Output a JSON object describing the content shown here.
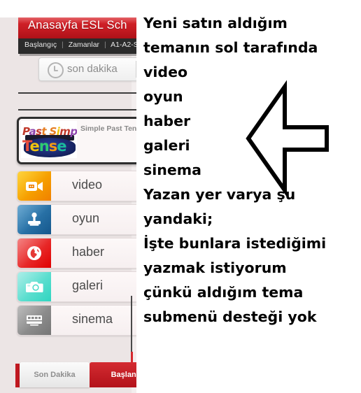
{
  "site": {
    "header": {
      "title": "Anasayfa   ESL Sch",
      "nav": [
        "Başlangıç",
        "Zamanlar",
        "A1-A2-S"
      ]
    },
    "ticker": {
      "icon": "clock-icon",
      "label": "son dakika"
    },
    "featured": {
      "thumb_line1": "Past Simple",
      "thumb_line2": "Tense",
      "title": "Simple Past Tense"
    },
    "menu": [
      {
        "label": "video",
        "icon": "video-camera-icon",
        "color": "#f39200"
      },
      {
        "label": "oyun",
        "icon": "joystick-icon",
        "color": "#1d6fa5"
      },
      {
        "label": "haber",
        "icon": "globe-icon",
        "color": "#e31e24"
      },
      {
        "label": "galeri",
        "icon": "camera-icon",
        "color": "#49d8c8"
      },
      {
        "label": "sinema",
        "icon": "film-strip-icon",
        "color": "#8c8c8c"
      }
    ],
    "tabs": [
      {
        "label": "Son Dakika",
        "active": false
      },
      {
        "label": "Başlang",
        "active": true
      }
    ]
  },
  "annotation": {
    "arrow": "left-arrow-outline",
    "lines": [
      "Yeni satın aldığım",
      "temanın sol tarafında",
      "video",
      "oyun",
      "haber",
      "galeri",
      "sinema",
      "Yazan yer varya şu",
      "yandaki;",
      "İşte bunlara istediğimi",
      "yazmak istiyorum",
      "çünkü aldığım tema",
      "submenü desteği yok"
    ]
  }
}
